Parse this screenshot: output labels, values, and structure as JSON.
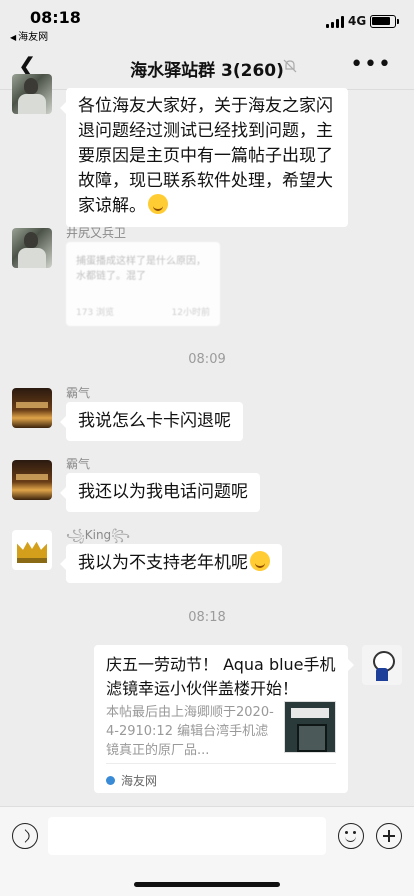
{
  "status_bar": {
    "time": "08:18",
    "back_app": "海友网",
    "network": "4G"
  },
  "nav": {
    "title": "海水驿站群 3(260)"
  },
  "messages": [
    {
      "text": "各位海友大家好，关于海友之家闪退问题经过测试已经找到问题，主要原因是主页中有一篇帖子出现了故障，现已联系软件处理，希望大家谅解。"
    },
    {
      "sender": "井尻又兵卫",
      "blurred_text": "捕蛋播成这样了是什么原因，水都链了。混了",
      "blurred_meta_left": "173 浏览",
      "blurred_meta_right": "12小时前"
    }
  ],
  "timestamps": [
    "08:09",
    "08:18"
  ],
  "chat": [
    {
      "sender": "霸气",
      "text": "我说怎么卡卡闪退呢"
    },
    {
      "sender": "霸气",
      "text": "我还以为我电话问题呢"
    },
    {
      "sender": "King",
      "text": "我以为不支持老年机呢"
    }
  ],
  "link_card": {
    "title": "庆五一劳动节！ Aqua blue手机滤镜幸运小伙伴盖楼开始！",
    "description": "本帖最后由上海卿顺于2020-4-2910:12 编辑台湾手机滤镜真正的原厂品...",
    "source": "海友网"
  },
  "icons": {
    "back": "chevron-left-icon",
    "mute": "bell-slash-icon",
    "more": "more-dots-icon",
    "voice": "voice-icon",
    "emoji": "emoji-icon",
    "plus": "plus-icon"
  }
}
